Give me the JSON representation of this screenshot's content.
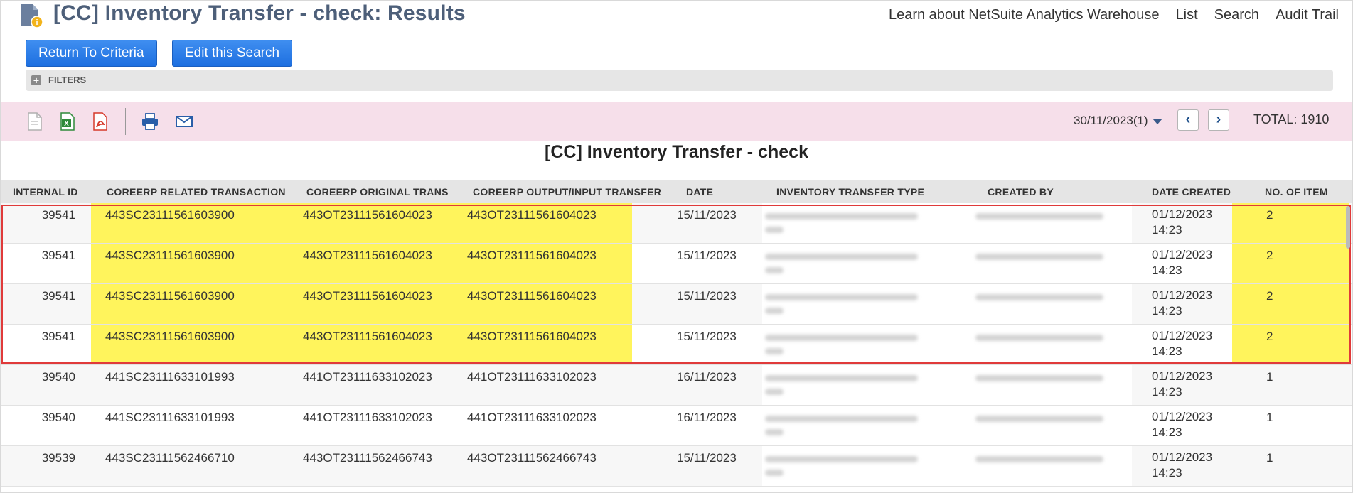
{
  "header": {
    "title": "[CC] Inventory Transfer - check: Results",
    "links": [
      "Learn about NetSuite Analytics Warehouse",
      "List",
      "Search",
      "Audit Trail"
    ]
  },
  "buttons": {
    "return": "Return To Criteria",
    "edit": "Edit this Search"
  },
  "filters": {
    "label": "FILTERS"
  },
  "toolbar": {
    "icons": [
      "export-csv-icon",
      "export-excel-icon",
      "export-pdf-icon",
      "print-icon",
      "email-icon"
    ],
    "pager_select": "30/11/2023(1)",
    "prev": "‹",
    "next": "›",
    "total": "TOTAL: 1910"
  },
  "report": {
    "title": "[CC] Inventory Transfer - check",
    "columns": [
      "INTERNAL ID",
      "COREERP RELATED TRANSACTION",
      "COREERP ORIGINAL TRANS",
      "COREERP OUTPUT/INPUT TRANSFER",
      "DATE",
      "INVENTORY TRANSFER TYPE",
      "CREATED BY",
      "DATE CREATED",
      "NO. OF ITEM"
    ],
    "rows": [
      {
        "id": "39541",
        "related": "443SC23111561603900",
        "original": "443OT23111561604023",
        "output": "443OT23111561604023",
        "date": "15/11/2023",
        "created_date": "01/12/2023",
        "created_time": "14:23",
        "items": "2",
        "highlighted": true
      },
      {
        "id": "39541",
        "related": "443SC23111561603900",
        "original": "443OT23111561604023",
        "output": "443OT23111561604023",
        "date": "15/11/2023",
        "created_date": "01/12/2023",
        "created_time": "14:23",
        "items": "2",
        "highlighted": true
      },
      {
        "id": "39541",
        "related": "443SC23111561603900",
        "original": "443OT23111561604023",
        "output": "443OT23111561604023",
        "date": "15/11/2023",
        "created_date": "01/12/2023",
        "created_time": "14:23",
        "items": "2",
        "highlighted": true
      },
      {
        "id": "39541",
        "related": "443SC23111561603900",
        "original": "443OT23111561604023",
        "output": "443OT23111561604023",
        "date": "15/11/2023",
        "created_date": "01/12/2023",
        "created_time": "14:23",
        "items": "2",
        "highlighted": true
      },
      {
        "id": "39540",
        "related": "441SC23111633101993",
        "original": "441OT23111633102023",
        "output": "441OT23111633102023",
        "date": "16/11/2023",
        "created_date": "01/12/2023",
        "created_time": "14:23",
        "items": "1",
        "highlighted": false
      },
      {
        "id": "39540",
        "related": "441SC23111633101993",
        "original": "441OT23111633102023",
        "output": "441OT23111633102023",
        "date": "16/11/2023",
        "created_date": "01/12/2023",
        "created_time": "14:23",
        "items": "1",
        "highlighted": false
      },
      {
        "id": "39539",
        "related": "443SC23111562466710",
        "original": "443OT23111562466743",
        "output": "443OT23111562466743",
        "date": "15/11/2023",
        "created_date": "01/12/2023",
        "created_time": "14:23",
        "items": "1",
        "highlighted": false
      }
    ]
  },
  "colors": {
    "title": "#4d5f79",
    "button": "#1d6fe0",
    "toolbar_bg": "#f6dfea",
    "highlight": "#fff45c",
    "selection_box": "#e03a3a"
  }
}
